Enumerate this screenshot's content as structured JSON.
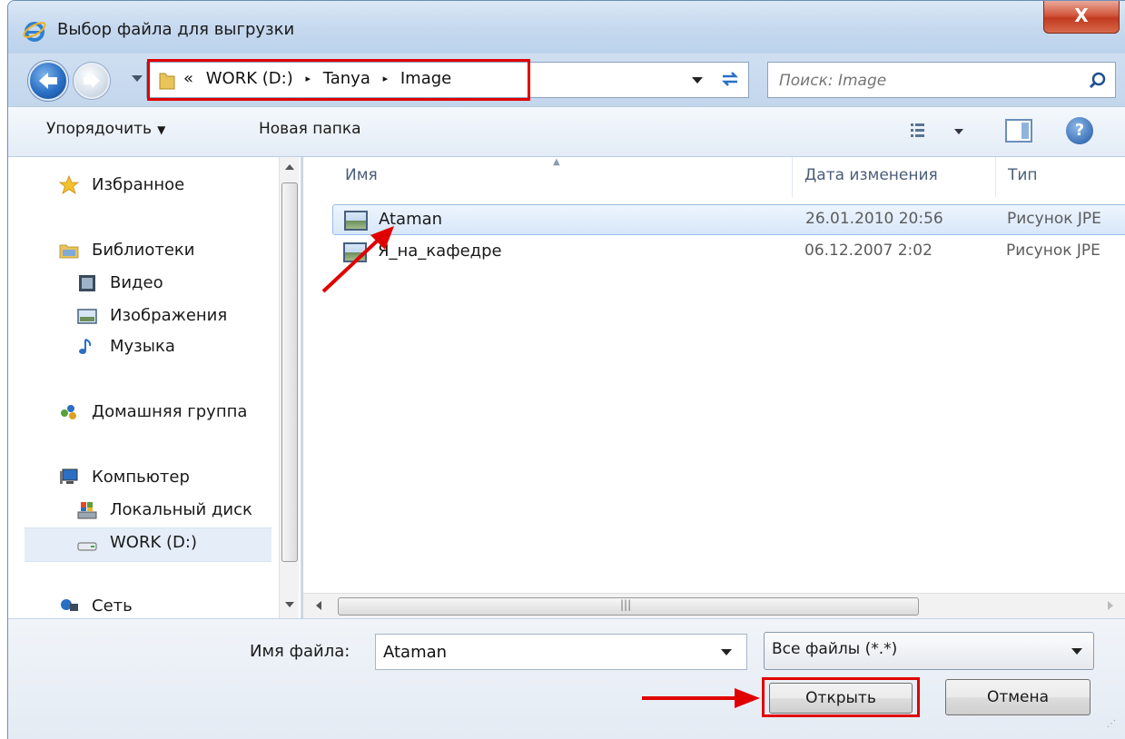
{
  "window": {
    "title": "Выбор файла для выгрузки",
    "close_label": "X"
  },
  "address": {
    "prefix": "«",
    "crumbs": [
      "WORK (D:)",
      "Tanya",
      "Image"
    ],
    "separator": "▸"
  },
  "search": {
    "placeholder": "Поиск: Image"
  },
  "toolbar": {
    "organize_label": "Упорядочить",
    "new_folder_label": "Новая папка",
    "help_label": "?"
  },
  "sidebar": {
    "favorites": "Избранное",
    "libraries": "Библиотеки",
    "video": "Видео",
    "images": "Изображения",
    "music": "Музыка",
    "homegroup": "Домашняя группа",
    "computer": "Компьютер",
    "local_disk": "Локальный диск",
    "work_drive": "WORK (D:)",
    "network": "Сеть"
  },
  "columns": {
    "name": "Имя",
    "date": "Дата изменения",
    "type": "Тип"
  },
  "files": [
    {
      "name": "Ataman",
      "date": "26.01.2010 20:56",
      "type": "Рисунок JPE"
    },
    {
      "name": "Я_на_кафедре",
      "date": "06.12.2007 2:02",
      "type": "Рисунок JPE"
    }
  ],
  "bottom": {
    "filename_label": "Имя файла:",
    "filename_value": "Ataman",
    "filter_value": "Все файлы (*.*)",
    "open_label": "Открыть",
    "cancel_label": "Отмена"
  },
  "colors": {
    "annotation_red": "#e10000",
    "selection_blue": "#d7e7fa",
    "frame_blue": "#c9dbef"
  },
  "icons": {
    "browser": "internet-explorer-icon",
    "back": "back-arrow-icon",
    "forward": "forward-arrow-icon",
    "folder": "folder-icon",
    "refresh": "refresh-icon",
    "search": "search-icon",
    "view": "view-options-icon",
    "preview": "preview-pane-icon",
    "help": "help-icon"
  }
}
